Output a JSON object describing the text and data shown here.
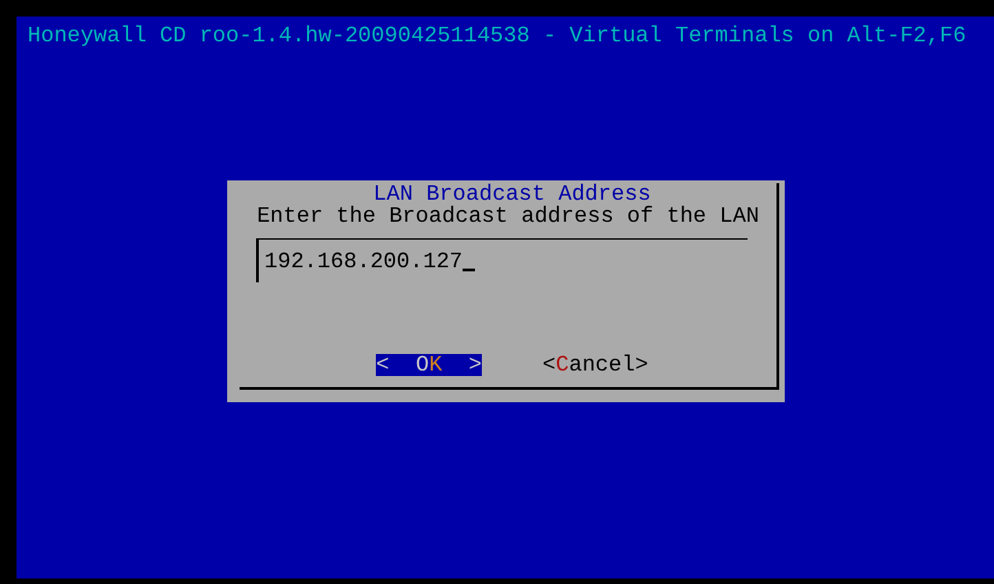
{
  "screen": {
    "title": "Honeywall CD roo-1.4.hw-20090425114538 - Virtual Terminals on Alt-F2,F6"
  },
  "dialog": {
    "title": "LAN Broadcast Address",
    "prompt": "Enter the Broadcast address of the LAN",
    "input": {
      "value": "192.168.200.127"
    },
    "buttons": [
      {
        "before": "<  O",
        "hotkey": "K",
        "after": "  >",
        "selected": true
      },
      {
        "before": "<",
        "hotkey": "C",
        "after": "ancel>",
        "selected": false
      }
    ]
  }
}
